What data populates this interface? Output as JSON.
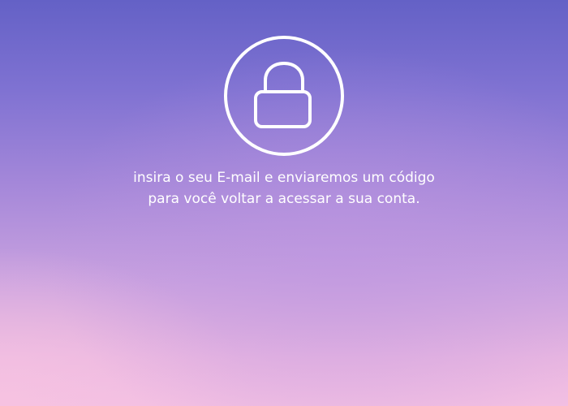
{
  "recovery": {
    "icon": "lock-icon",
    "message": "insira o seu E-mail e enviaremos um código para você voltar a acessar a sua conta."
  }
}
